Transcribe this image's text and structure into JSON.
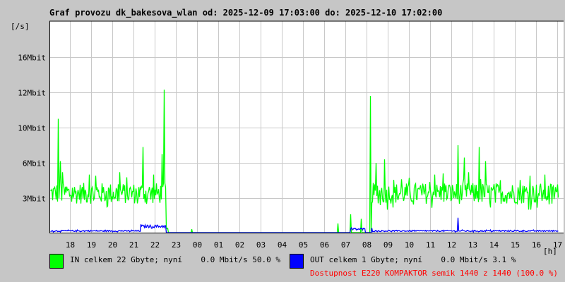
{
  "chart_data": {
    "type": "line",
    "title": "Graf provozu dk_bakesova_wlan od: 2025-12-09 17:03:00 do: 2025-12-10 17:02:00",
    "ylabel": "[/s]",
    "xlabel": "[h]",
    "x_unit": "hours since 17:00 on 2025-12-09",
    "xlim": [
      0.05,
      24.05
    ],
    "y_ticks": [
      {
        "label": "3Mbit",
        "value": 3
      },
      {
        "label": "6Mbit",
        "value": 6
      },
      {
        "label": "10Mbit",
        "value": 10
      },
      {
        "label": "12Mbit",
        "value": 12
      },
      {
        "label": "16Mbit",
        "value": 16
      }
    ],
    "x_ticks": [
      "18",
      "19",
      "20",
      "21",
      "22",
      "23",
      "00",
      "01",
      "02",
      "03",
      "04",
      "05",
      "06",
      "07",
      "08",
      "09",
      "10",
      "11",
      "12",
      "13",
      "14",
      "15",
      "16",
      "17"
    ],
    "grid": true,
    "series": [
      {
        "name": "IN",
        "color": "#00ff00",
        "segments": [
          {
            "from": 0.05,
            "to": 5.5,
            "base": 3.4,
            "jitter": 0.9
          },
          {
            "from": 5.5,
            "to": 5.6,
            "base": 0.3,
            "jitter": 0.1
          },
          {
            "from": 15.2,
            "to": 24.05,
            "base": 3.4,
            "jitter": 0.9
          }
        ],
        "spikes": [
          [
            0.4,
            10.5
          ],
          [
            0.5,
            6.2
          ],
          [
            0.6,
            5.2
          ],
          [
            1.9,
            5.0
          ],
          [
            2.2,
            4.9
          ],
          [
            3.3,
            5.2
          ],
          [
            4.4,
            7.8
          ],
          [
            4.9,
            5.0
          ],
          [
            5.3,
            7.0
          ],
          [
            5.42,
            12.3
          ],
          [
            6.7,
            0.3
          ],
          [
            13.6,
            0.8
          ],
          [
            14.2,
            1.6
          ],
          [
            14.7,
            1.2
          ],
          [
            15.15,
            11.8
          ],
          [
            15.4,
            6.0
          ],
          [
            15.8,
            6.4
          ],
          [
            16.6,
            4.6
          ],
          [
            18.2,
            5.0
          ],
          [
            18.6,
            5.1
          ],
          [
            19.3,
            8.0
          ],
          [
            19.6,
            6.6
          ],
          [
            19.8,
            5.2
          ],
          [
            20.3,
            7.8
          ],
          [
            20.6,
            6.2
          ],
          [
            22.7,
            4.9
          ],
          [
            23.4,
            5.0
          ]
        ]
      },
      {
        "name": "OUT",
        "color": "#0000ff",
        "segments": [
          {
            "from": 0.05,
            "to": 4.3,
            "base": 0.15,
            "jitter": 0.06
          },
          {
            "from": 4.3,
            "to": 5.5,
            "base": 0.55,
            "jitter": 0.12
          },
          {
            "from": 14.2,
            "to": 14.9,
            "base": 0.3,
            "jitter": 0.1
          },
          {
            "from": 15.2,
            "to": 24.05,
            "base": 0.15,
            "jitter": 0.06
          }
        ],
        "spikes": [
          [
            19.3,
            1.3
          ],
          [
            15.2,
            0.4
          ]
        ]
      }
    ]
  },
  "legend": {
    "in_text": "IN celkem 22 Gbyte; nyní    0.0 Mbit/s 50.0 %",
    "out_text": "OUT celkem 1 Gbyte; nyní    0.0 Mbit/s 3.1 %",
    "availability": "Dostupnost E220 KOMPAKTOR semik 1440 z 1440 (100.0 %)"
  }
}
